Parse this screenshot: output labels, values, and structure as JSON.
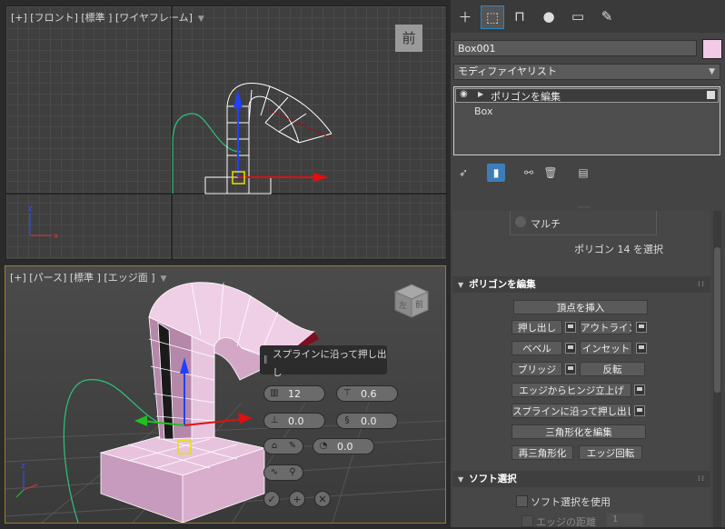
{
  "viewport_top": {
    "label": "[+] [フロント] [標準 ] [ワイヤフレーム]",
    "cube_label": "前"
  },
  "viewport_persp": {
    "label": "[+] [パース] [標準 ] [エッジ面 ]",
    "cube_face_front": "前",
    "cube_face_left": "左",
    "caddy": {
      "title": "スプラインに沿って押し出し",
      "segments": "12",
      "taper_amount": "0.6",
      "taper_curve": "0.0",
      "twist": "0.0",
      "rotation": "0.0"
    }
  },
  "panel": {
    "object_name": "Box001",
    "object_color": "#f2c9e6",
    "modifier_list": "モディファイヤリスト",
    "stack_items": [
      "ポリゴンを編集",
      "Box"
    ],
    "partial_label": "マルチ",
    "selection_status": "ポリゴン 14 を選択",
    "edit_poly_rollout": {
      "title": "ポリゴンを編集",
      "insert_vertex": "頂点を挿入",
      "extrude": "押し出し",
      "outline": "アウトライン",
      "bevel": "ベベル",
      "inset": "インセット",
      "bridge": "ブリッジ",
      "flip": "反転",
      "hinge_from_edge": "エッジからヒンジ立上げ",
      "extrude_along_spline": "スプラインに沿って押し出し",
      "edit_triangulation": "三角形化を編集",
      "retriangulate": "再三角形化",
      "turn_edge": "エッジ回転"
    },
    "soft_selection_rollout": {
      "title": "ソフト選択",
      "use_soft_selection": "ソフト選択を使用",
      "edge_distance": "エッジの距離",
      "edge_distance_value": "1"
    }
  }
}
